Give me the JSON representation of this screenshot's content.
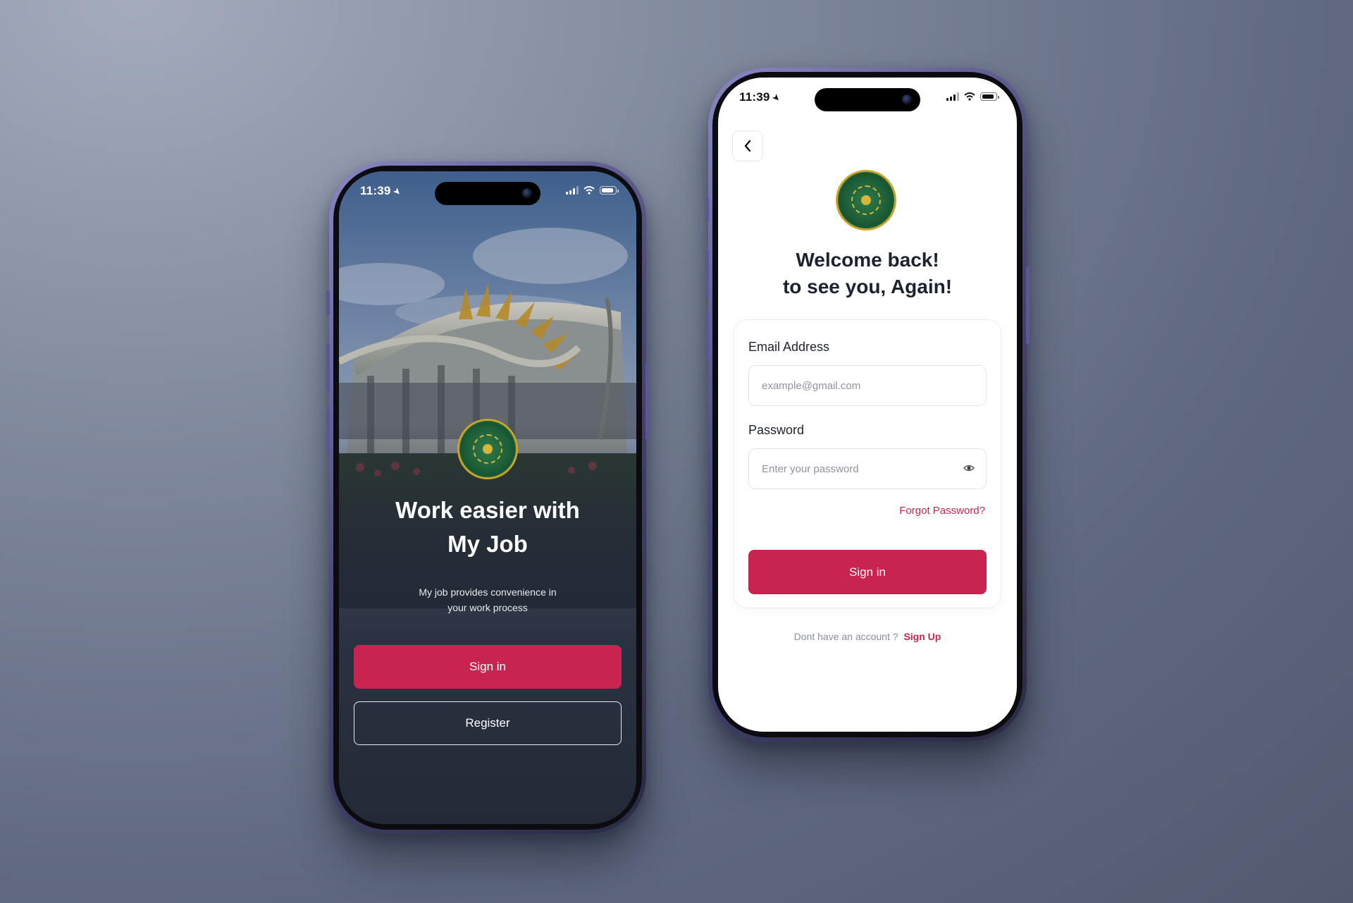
{
  "left_phone": {
    "status": {
      "time": "11:39"
    },
    "welcome": {
      "title_line1": "Work easier with",
      "title_line2": "My Job",
      "subtitle_line1": "My job provides convenience in",
      "subtitle_line2": "your work process"
    },
    "buttons": {
      "sign_in": "Sign in",
      "register": "Register"
    }
  },
  "right_phone": {
    "status": {
      "time": "11:39"
    },
    "heading_line1": "Welcome back!",
    "heading_line2": "to see you, Again!",
    "form": {
      "email_label": "Email Address",
      "email_placeholder": "example@gmail.com",
      "password_label": "Password",
      "password_placeholder": "Enter your password",
      "forgot": "Forgot Password?",
      "sign_in": "Sign in"
    },
    "footer": {
      "prompt": "Dont have an account ?",
      "link": "Sign Up"
    }
  },
  "colors": {
    "primary": "#c8244f",
    "dark_bg": "#232a37",
    "logo_green": "#1d5e38",
    "logo_gold": "#c7a52c"
  }
}
